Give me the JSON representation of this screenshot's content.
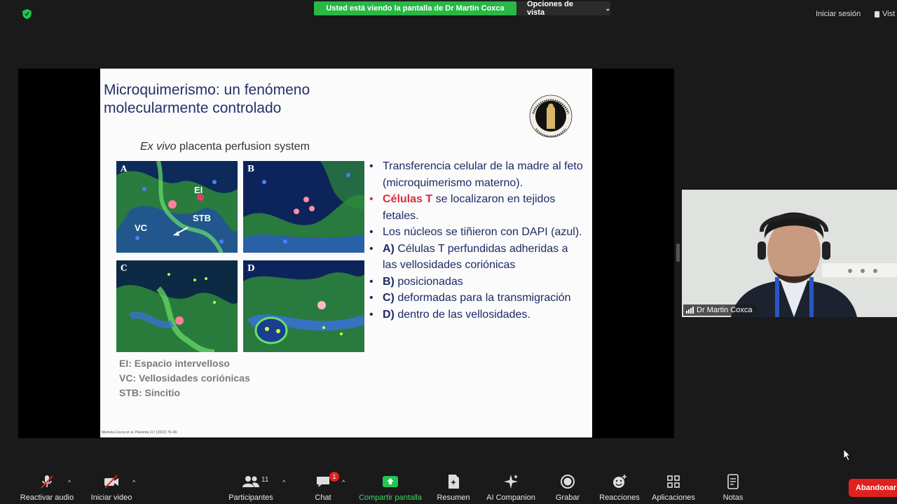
{
  "topbar": {
    "viewing_banner": "Usted está viendo la pantalla de Dr Martin Coxca",
    "view_options": "Opciones de vista",
    "sign_in": "Iniciar sesión",
    "view": "Vist",
    "banner_color": "#27b845"
  },
  "slide": {
    "title_line1": "Microquimerismo: un fenómeno",
    "title_line2": "molecularmente controlado",
    "subtitle_italic": "Ex vivo",
    "subtitle_rest": " placenta perfusion system",
    "panels": [
      {
        "label": "A"
      },
      {
        "label": "B"
      },
      {
        "label": "C"
      },
      {
        "label": "D"
      }
    ],
    "annotations": {
      "ei": "EI",
      "stb": "STB",
      "vc": "VC"
    },
    "bullets": {
      "b1": "Transferencia celular de la madre al feto (microquimerismo materno).",
      "b2_red": "Células T",
      "b2_rest": " se localizaron en tejidos fetales.",
      "b3": "Los núcleos se tiñieron con DAPI (azul).",
      "b4_bold": "A)",
      "b4_rest": " Células T perfundidas adheridas a las vellosidades coriónicas",
      "b5_bold": "B)",
      "b5_rest": " posicionadas",
      "b6_bold": "C)",
      "b6_rest": " deformadas para la transmigración",
      "b7_bold": "D)",
      "b7_rest": " dentro de las vellosidades."
    },
    "legend": {
      "l1": "EI: Espacio intervelloso",
      "l2": "VC: Vellosidades coriónicas",
      "l3": "STB: Sincitio"
    },
    "citation": "Murrieta-Coxca et al. Placenta 117 (2022) 79–86"
  },
  "participant": {
    "name": "Dr Martin Coxca"
  },
  "toolbar": {
    "audio": "Reactivar audio",
    "video": "Iniciar video",
    "participants": "Participantes",
    "participants_count": "11",
    "chat": "Chat",
    "chat_badge": "1",
    "share": "Compartir pantalla",
    "summary": "Resumen",
    "ai": "AI Companion",
    "record": "Grabar",
    "reactions": "Reacciones",
    "apps": "Aplicaciones",
    "notes": "Notas",
    "leave": "Abandonar",
    "share_color": "#23c552",
    "leave_color": "#e0211e"
  }
}
